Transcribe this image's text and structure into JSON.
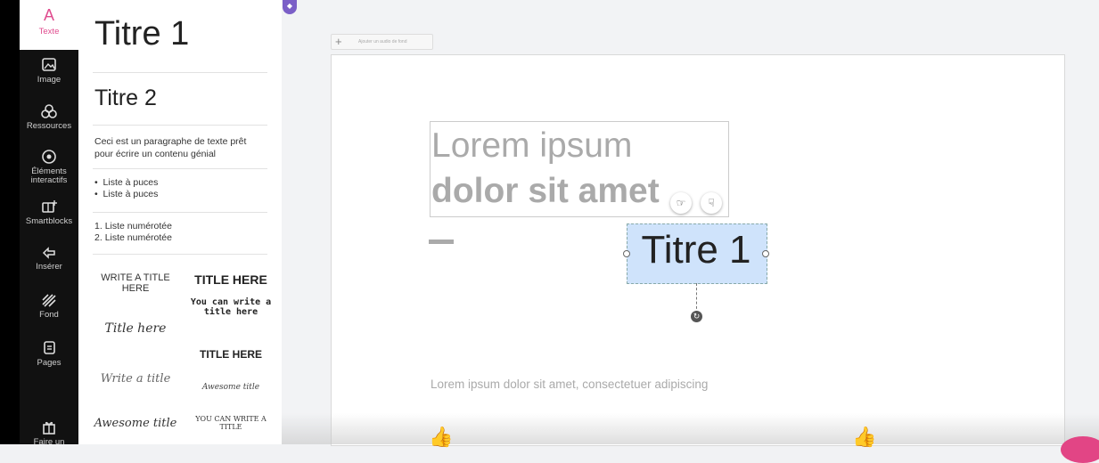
{
  "sidebar": {
    "items": [
      {
        "label": "Texte",
        "icon": "text-icon"
      },
      {
        "label": "Image",
        "icon": "image-icon"
      },
      {
        "label": "Ressources",
        "icon": "resources-icon"
      },
      {
        "label1": "Éléments",
        "label2": "interactifs",
        "icon": "interactive-elements-icon"
      },
      {
        "label": "Smartblocks",
        "icon": "smartblocks-icon"
      },
      {
        "label": "Insérer",
        "icon": "insert-icon"
      },
      {
        "label": "Fond",
        "icon": "background-icon"
      },
      {
        "label": "Pages",
        "icon": "pages-icon"
      },
      {
        "label": "Faire un",
        "icon": "gift-icon"
      }
    ],
    "active_color": "#e04d8f"
  },
  "panel": {
    "title1": "Titre 1",
    "title2": "Titre 2",
    "paragraph": "Ceci est un paragraphe de texte prêt pour écrire un contenu génial",
    "bullets": [
      "Liste à puces",
      "Liste à puces"
    ],
    "numbered": [
      "Liste numérotée",
      "Liste numérotée"
    ],
    "templates": {
      "a1": "WRITE A TITLE HERE",
      "b1": "TITLE HERE",
      "b2": "You can write a title here",
      "a2": "Title here",
      "b3": "TITLE HERE",
      "a3": "Write a title",
      "b4": "Awesome title",
      "a4": "Awesome title",
      "b5": "YOU CAN WRITE A TITLE"
    }
  },
  "canvas": {
    "add_background": "Ajouter un audio de fond",
    "lorem_line1": "Lorem ipsum",
    "lorem_line2": "dolor sit amet",
    "selected_text": "Titre 1",
    "lorem_small": "Lorem ipsum dolor sit amet, consectetuer adipiscing"
  },
  "colors": {
    "selection": "#cfe3fb",
    "accent": "#e04d8f",
    "badge": "#7b5fc7"
  }
}
